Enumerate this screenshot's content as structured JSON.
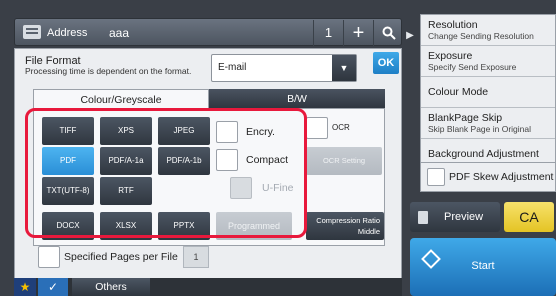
{
  "address_bar": {
    "label": "Address",
    "value": "aaa",
    "count": "1",
    "plus_symbol": "+"
  },
  "file_format": {
    "title": "File Format",
    "description": "Processing time is dependent on the format.",
    "destination": "E-mail",
    "ok_label": "OK",
    "tabs": [
      "Colour/Greyscale",
      "B/W"
    ],
    "active_tab": "Colour/Greyscale",
    "formats_row1": [
      "TIFF",
      "XPS",
      "JPEG"
    ],
    "formats_row2": [
      "PDF",
      "PDF/A-1a",
      "PDF/A-1b"
    ],
    "formats_row3": [
      "TXT(UTF-8)",
      "RTF"
    ],
    "formats_row4": [
      "DOCX",
      "XLSX",
      "PPTX"
    ],
    "selected_format": "PDF",
    "encry_label": "Encry.",
    "compact_label": "Compact",
    "ufine_label": "U-Fine",
    "programmed_label": "Programmed",
    "ocr_label": "OCR",
    "ocr_setting_label": "OCR Setting",
    "compression_label": "Compression Ratio",
    "compression_value": "Middle",
    "specified_pages_label": "Specified Pages per File",
    "specified_pages_count": "1"
  },
  "bottom": {
    "star_symbol": "★",
    "check_symbol": "✓",
    "others_label": "Others"
  },
  "side_menu": {
    "items": [
      {
        "title": "Resolution",
        "subtitle": "Change Sending Resolution"
      },
      {
        "title": "Exposure",
        "subtitle": "Specify Send Exposure"
      },
      {
        "title": "Colour Mode",
        "subtitle": ""
      },
      {
        "title": "BlankPage Skip",
        "subtitle": "Skip Blank Page in Original"
      },
      {
        "title": "Background Adjustment",
        "subtitle": ""
      }
    ],
    "skew_label": "PDF Skew Adjustment"
  },
  "actions": {
    "preview_label": "Preview",
    "ca_label": "CA",
    "start_label": "Start"
  },
  "colors": {
    "highlight": "#e8193c",
    "selected": "#2a8ed6",
    "ca": "#e4c424"
  }
}
